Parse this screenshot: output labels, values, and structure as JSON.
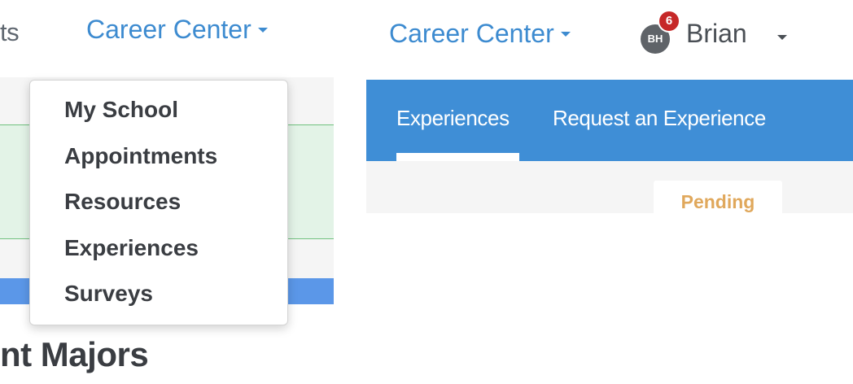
{
  "left": {
    "partial_nav_text": "ts",
    "career_center_label": "Career Center",
    "dropdown_items": [
      "My School",
      "Appointments",
      "Resources",
      "Experiences",
      "Surveys"
    ],
    "heading_partial": "nt Majors"
  },
  "right": {
    "career_center_label": "Career Center",
    "user": {
      "initials": "BH",
      "name": "Brian",
      "notification_count": "6"
    },
    "tabs": [
      {
        "label": "Experiences",
        "active": true
      },
      {
        "label": "Request an Experience",
        "active": false
      }
    ],
    "status_tab_label": "Pending"
  },
  "colors": {
    "link_blue": "#3d8bd0",
    "tab_bar_blue": "#3f8ed6",
    "badge_red": "#c62828",
    "pending_orange": "#e0a85c"
  },
  "icons": [
    "chevron-down-icon",
    "avatar",
    "notification-badge"
  ]
}
